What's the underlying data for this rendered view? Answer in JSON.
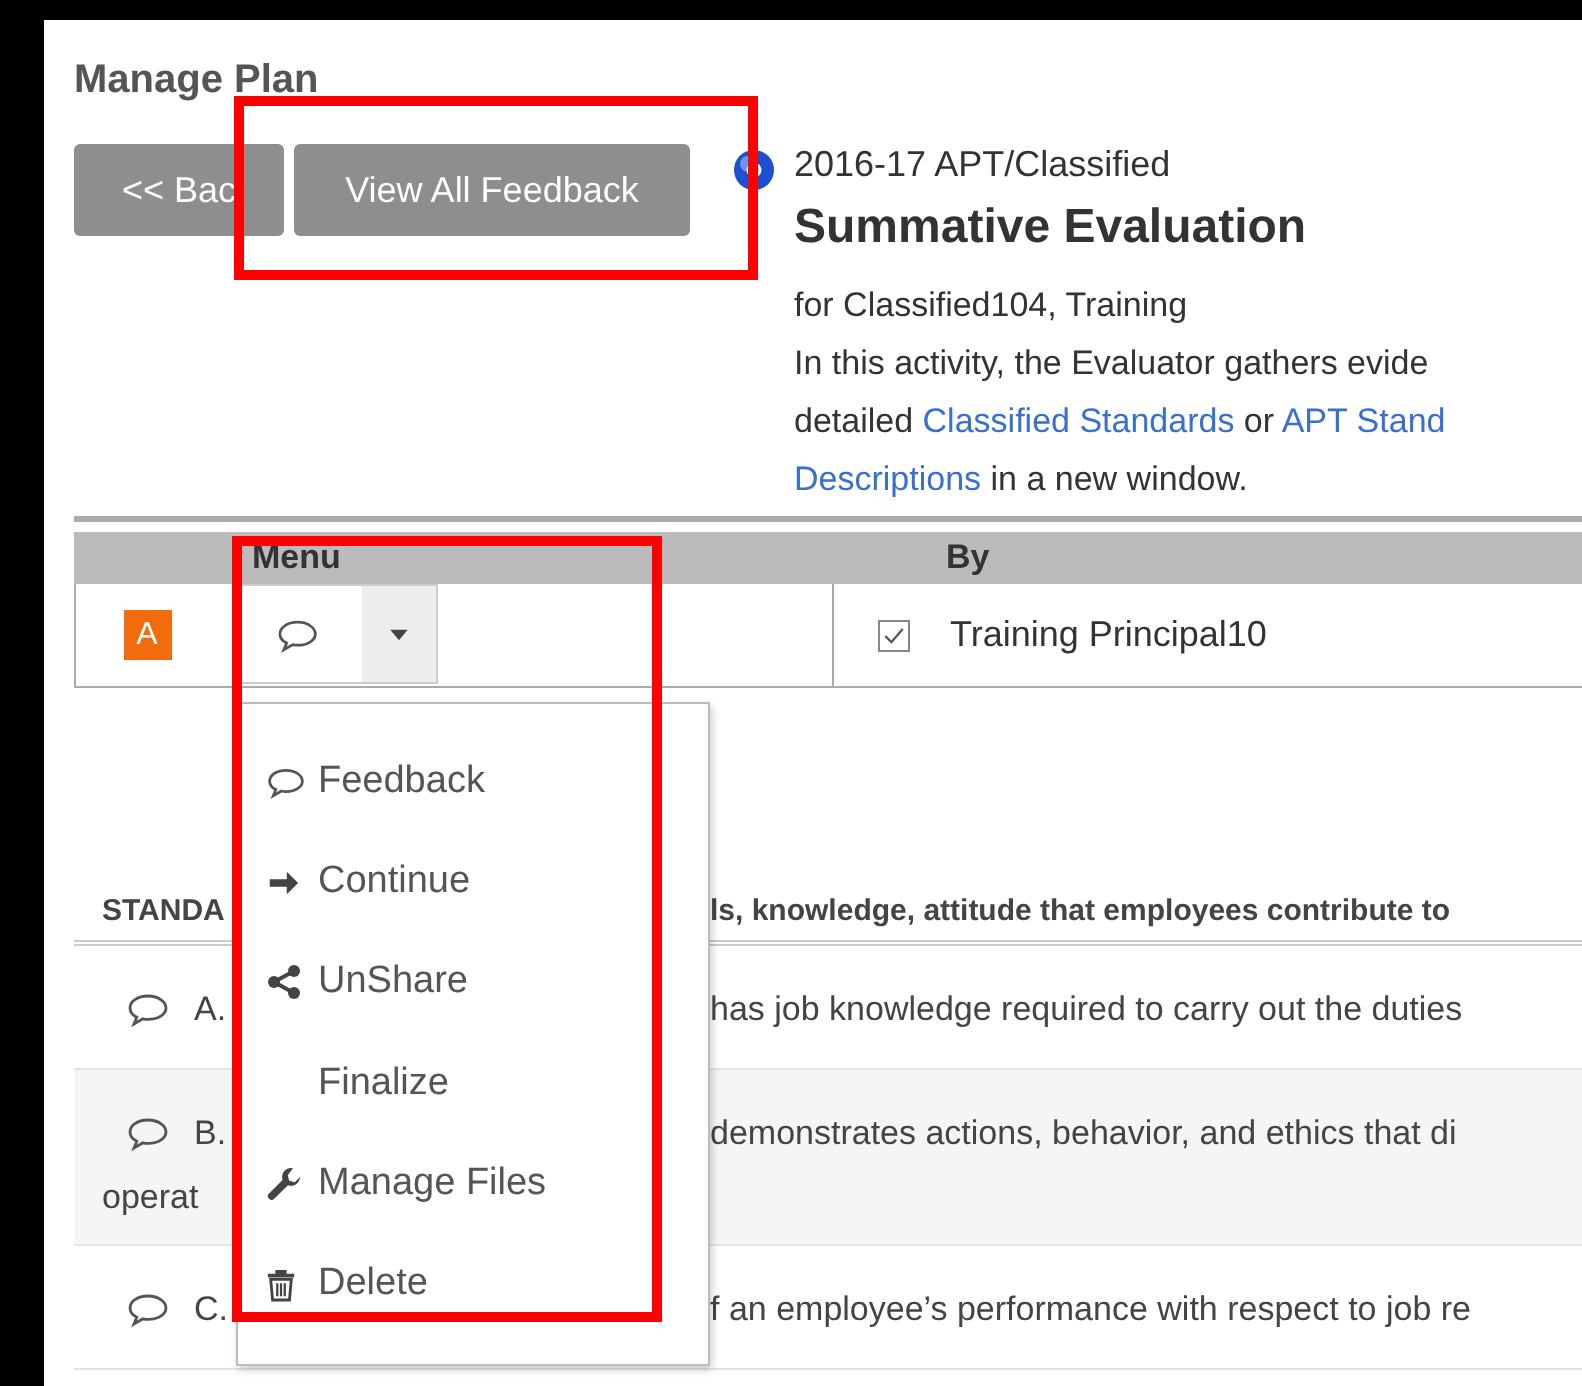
{
  "page": {
    "title": "Manage Plan"
  },
  "buttons": [
    {
      "label": "<< Bac"
    },
    {
      "label": "View All Feedback"
    }
  ],
  "plan": {
    "year": "2016-17 APT/Classified",
    "title": "Summative Evaluation",
    "subject": "for Classified104, Training",
    "description": [
      [
        {
          "kind": "text",
          "text": "In this activity, the Evaluator gathers evide"
        }
      ],
      [
        {
          "kind": "text",
          "text": "detailed "
        },
        {
          "kind": "link",
          "text": "Classified Standards"
        },
        {
          "kind": "text",
          "text": " or "
        },
        {
          "kind": "link",
          "text": "APT Stand"
        }
      ],
      [
        {
          "kind": "link",
          "text": "Descriptions"
        },
        {
          "kind": "text",
          "text": " in a new window."
        }
      ]
    ]
  },
  "table": {
    "columns": [
      "Menu",
      "By"
    ],
    "rows": [
      {
        "badge": "A",
        "checked": true,
        "by": "Training Principal10"
      }
    ]
  },
  "dropdown": [
    {
      "label": "Feedback",
      "kind": "comment"
    },
    {
      "label": "Continue",
      "kind": "continue"
    },
    {
      "label": "UnShare",
      "kind": "share"
    },
    {
      "label": "Finalize",
      "kind": "plain"
    },
    {
      "label": "Manage Files",
      "kind": "files"
    },
    {
      "label": "Delete",
      "kind": "delete"
    }
  ],
  "standards": {
    "header_left": "STANDA",
    "header_right": "ls, knowledge, attitude that employees contribute to",
    "rows": [
      {
        "label": "A.",
        "more": [],
        "text": "has job knowledge required to carry out the duties"
      },
      {
        "label": "B.",
        "more": [
          "operat"
        ],
        "text": "demonstrates actions, behavior, and ethics that di"
      },
      {
        "label": "C.",
        "more": [],
        "text": "f an employee’s performance with respect to job re"
      }
    ]
  }
}
